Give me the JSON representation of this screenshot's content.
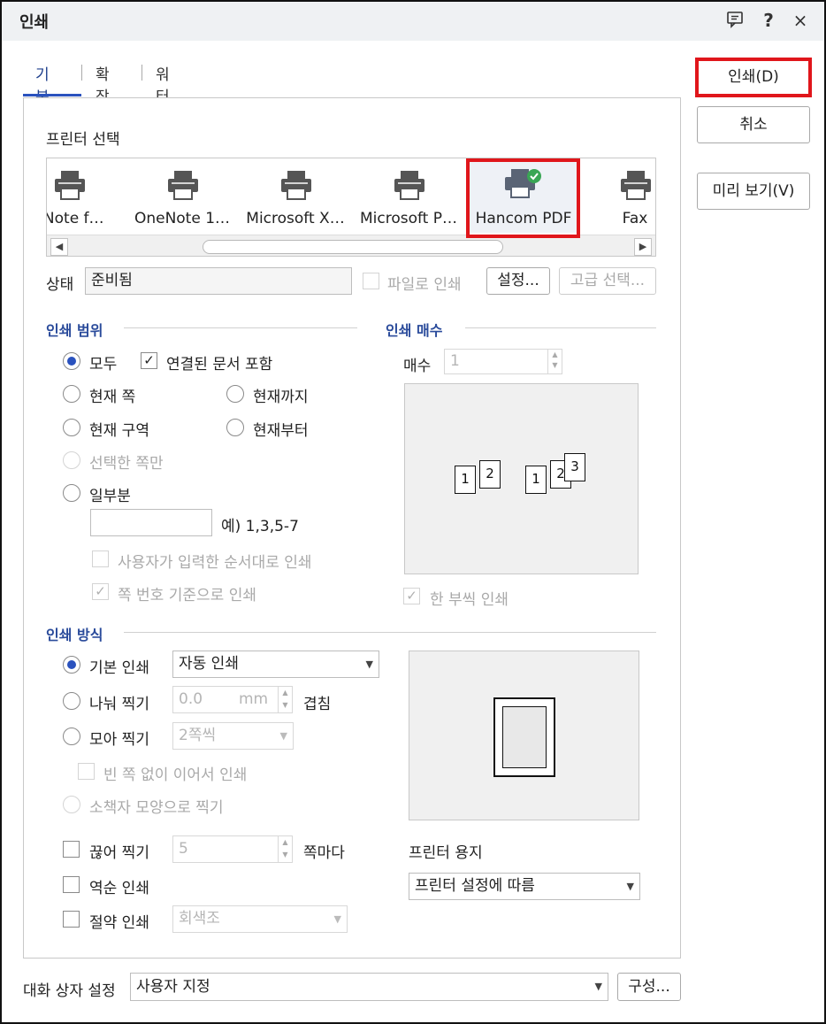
{
  "window": {
    "title": "인쇄"
  },
  "titlebar_icons": [
    "comment-icon",
    "help-icon",
    "close-icon"
  ],
  "titlebar_glyphs": {
    "help": "?",
    "close": "×"
  },
  "tabs": [
    {
      "label": "기본",
      "active": true
    },
    {
      "label": "확장",
      "active": false
    },
    {
      "label": "워터마크",
      "active": false
    }
  ],
  "side_buttons": {
    "print": "인쇄(D)",
    "cancel": "취소",
    "preview": "미리 보기(V)"
  },
  "printer_select": {
    "label": "프린터 선택",
    "printers": [
      "eNote f…",
      "OneNote 1…",
      "Microsoft X…",
      "Microsoft P…",
      "Hancom PDF",
      "Fax"
    ],
    "selected": "Hancom PDF"
  },
  "status": {
    "label": "상태",
    "value": "준비됨",
    "print_to_file": "파일로 인쇄",
    "settings_button": "설정...",
    "advanced_button": "고급 선택..."
  },
  "print_range": {
    "title": "인쇄 범위",
    "all": "모두",
    "include_linked": "연결된 문서 포함",
    "current_page": "현재 쪽",
    "up_to_current": "현재까지",
    "current_section": "현재 구역",
    "from_current": "현재부터",
    "selected_pages": "선택한 쪽만",
    "partial": "일부분",
    "partial_example": "예) 1,3,5-7",
    "user_order": "사용자가 입력한 순서대로 인쇄",
    "page_number_basis": "쪽 번호 기준으로 인쇄"
  },
  "copies": {
    "title": "인쇄 매수",
    "label": "매수",
    "value": "1",
    "collate": "한 부씩 인쇄",
    "sheet_numbers": [
      "1",
      "2",
      "3"
    ]
  },
  "print_method": {
    "title": "인쇄 방식",
    "basic": "기본 인쇄",
    "basic_value": "자동 인쇄",
    "split": "나눠 찍기",
    "split_value": "0.0",
    "split_unit": "mm",
    "overlap": "겹침",
    "nup": "모아 찍기",
    "nup_value": "2쪽씩",
    "no_blank": "빈 쪽 없이 이어서 인쇄",
    "booklet": "소책자 모양으로 찍기",
    "break_print": "끊어 찍기",
    "break_value": "5",
    "break_suffix": "쪽마다",
    "reverse": "역순 인쇄",
    "economy": "절약 인쇄",
    "economy_value": "회색조"
  },
  "printer_paper": {
    "label": "프린터 용지",
    "value": "프린터 설정에 따름"
  },
  "dialog_settings": {
    "label": "대화 상자 설정",
    "value": "사용자 지정",
    "config_button": "구성..."
  },
  "colors": {
    "accent": "#2a52be",
    "section": "#2a4b9b",
    "highlight": "#e0161b",
    "check_badge": "#3aa655"
  }
}
